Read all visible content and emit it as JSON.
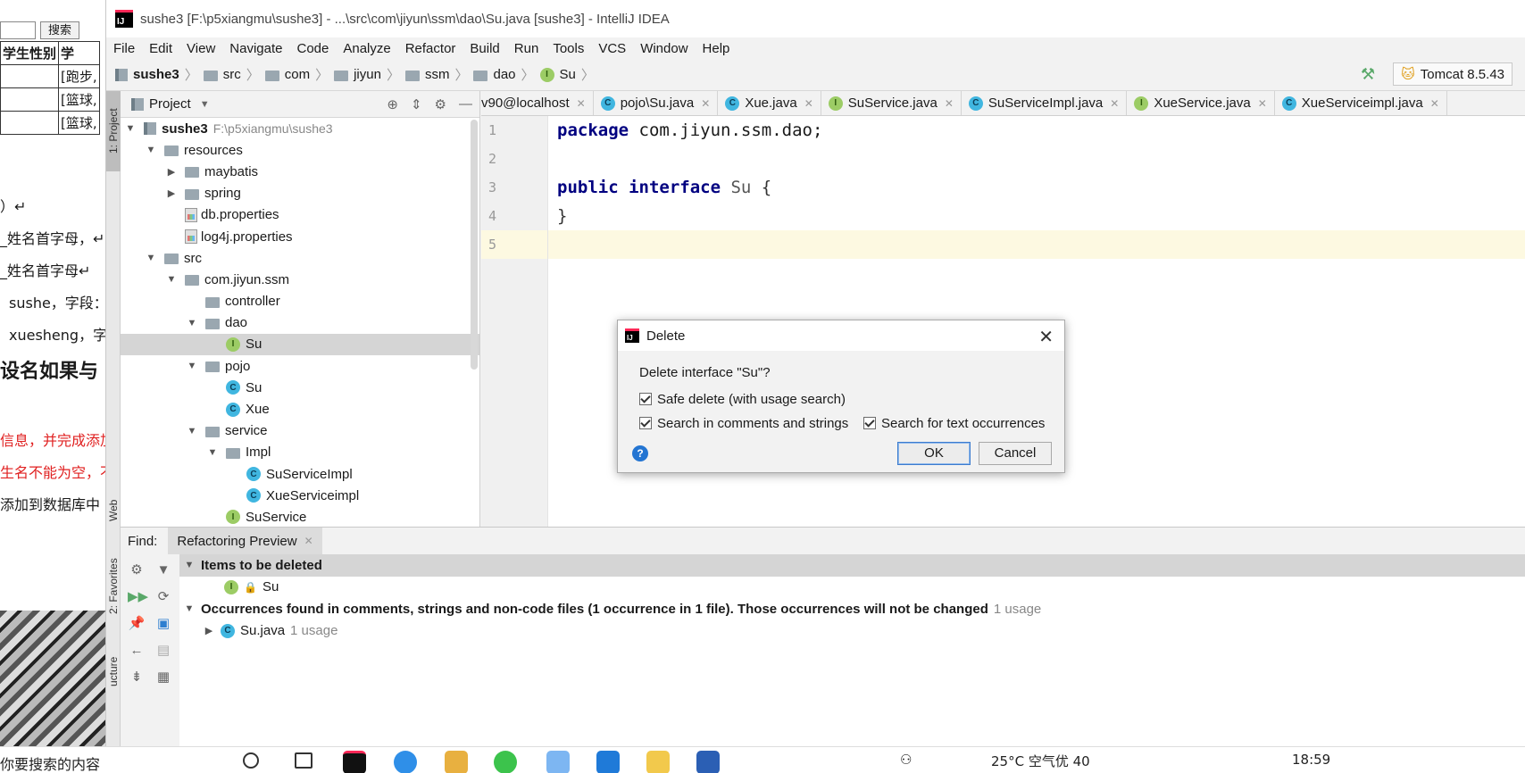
{
  "background_doc": {
    "search_button": "搜索",
    "table_headers": [
      "学生性别",
      "学"
    ],
    "table_rows": [
      "[跑步,",
      "[篮球,",
      "[篮球,"
    ],
    "lines": [
      "）↵",
      "_姓名首字母，↵",
      "_姓名首字母↵",
      "sushe，字段：",
      "xuesheng，字",
      "设名如果与",
      "信息，并完成添加",
      "生名不能为空，不",
      "添加到数据库中"
    ],
    "taskbar_search": "你要搜索的内容"
  },
  "window": {
    "title": "sushe3 [F:\\p5xiangmu\\sushe3] - ...\\src\\com\\jiyun\\ssm\\dao\\Su.java [sushe3] - IntelliJ IDEA",
    "logo_text": "IJ"
  },
  "menu": [
    "File",
    "Edit",
    "View",
    "Navigate",
    "Code",
    "Analyze",
    "Refactor",
    "Build",
    "Run",
    "Tools",
    "VCS",
    "Window",
    "Help"
  ],
  "breadcrumb": [
    "sushe3",
    "src",
    "com",
    "jiyun",
    "ssm",
    "dao",
    "Su"
  ],
  "run_config": "Tomcat 8.5.43",
  "left_strip": {
    "project": "1: Project",
    "web": "Web",
    "favorites": "2: Favorites",
    "structure": "ucture"
  },
  "project_panel": {
    "title": "Project",
    "root_name": "sushe3",
    "root_path": "F:\\p5xiangmu\\sushe3",
    "items": [
      {
        "label": "resources",
        "depth": 1,
        "arrow": "down",
        "icon": "folder"
      },
      {
        "label": "maybatis",
        "depth": 2,
        "arrow": "right",
        "icon": "folder"
      },
      {
        "label": "spring",
        "depth": 2,
        "arrow": "right",
        "icon": "folder"
      },
      {
        "label": "db.properties",
        "depth": 2,
        "arrow": "none",
        "icon": "file"
      },
      {
        "label": "log4j.properties",
        "depth": 2,
        "arrow": "none",
        "icon": "file"
      },
      {
        "label": "src",
        "depth": 1,
        "arrow": "down",
        "icon": "folder"
      },
      {
        "label": "com.jiyun.ssm",
        "depth": 2,
        "arrow": "down",
        "icon": "folder"
      },
      {
        "label": "controller",
        "depth": 3,
        "arrow": "none",
        "icon": "folder"
      },
      {
        "label": "dao",
        "depth": 3,
        "arrow": "down",
        "icon": "folder"
      },
      {
        "label": "Su",
        "depth": 4,
        "arrow": "none",
        "icon": "interface",
        "selected": true
      },
      {
        "label": "pojo",
        "depth": 3,
        "arrow": "down",
        "icon": "folder"
      },
      {
        "label": "Su",
        "depth": 4,
        "arrow": "none",
        "icon": "class"
      },
      {
        "label": "Xue",
        "depth": 4,
        "arrow": "none",
        "icon": "class"
      },
      {
        "label": "service",
        "depth": 3,
        "arrow": "down",
        "icon": "folder"
      },
      {
        "label": "Impl",
        "depth": 4,
        "arrow": "down",
        "icon": "folder"
      },
      {
        "label": "SuServiceImpl",
        "depth": 5,
        "arrow": "none",
        "icon": "class"
      },
      {
        "label": "XueServiceimpl",
        "depth": 5,
        "arrow": "none",
        "icon": "class"
      },
      {
        "label": "SuService",
        "depth": 4,
        "arrow": "none",
        "icon": "interface"
      }
    ]
  },
  "editor_tabs": [
    {
      "label": "v90@localhost",
      "icon": "none"
    },
    {
      "label": "pojo\\Su.java",
      "icon": "class"
    },
    {
      "label": "Xue.java",
      "icon": "class"
    },
    {
      "label": "SuService.java",
      "icon": "interface"
    },
    {
      "label": "SuServiceImpl.java",
      "icon": "class"
    },
    {
      "label": "XueService.java",
      "icon": "interface"
    },
    {
      "label": "XueServiceimpl.java",
      "icon": "class"
    }
  ],
  "code": {
    "line_numbers": [
      "1",
      "2",
      "3",
      "4",
      "5"
    ],
    "line1_kw": "package",
    "line1_rest": " com.jiyun.ssm.dao;",
    "line3_kw": "public interface",
    "line3_name": " Su",
    "line3_brace": " {",
    "line4": "}"
  },
  "dialog": {
    "title": "Delete",
    "question": "Delete interface \"Su\"?",
    "opt_safe_delete": "Safe delete (with usage search)",
    "opt_comments": "Search in comments and strings",
    "opt_text": "Search for text occurrences",
    "ok": "OK",
    "cancel": "Cancel",
    "help": "?"
  },
  "find_panel": {
    "label": "Find:",
    "tab": "Refactoring Preview",
    "group1": "Items to be deleted",
    "item1": "Su",
    "group2": "Occurrences found in comments, strings and non-code files  (1 occurrence in 1 file). Those occurrences will not be changed",
    "group2_usage": "1 usage",
    "file": "Su.java",
    "file_usage": "1 usage"
  },
  "taskbar": {
    "weather": "25°C  空气优 40",
    "time": "18:59"
  }
}
